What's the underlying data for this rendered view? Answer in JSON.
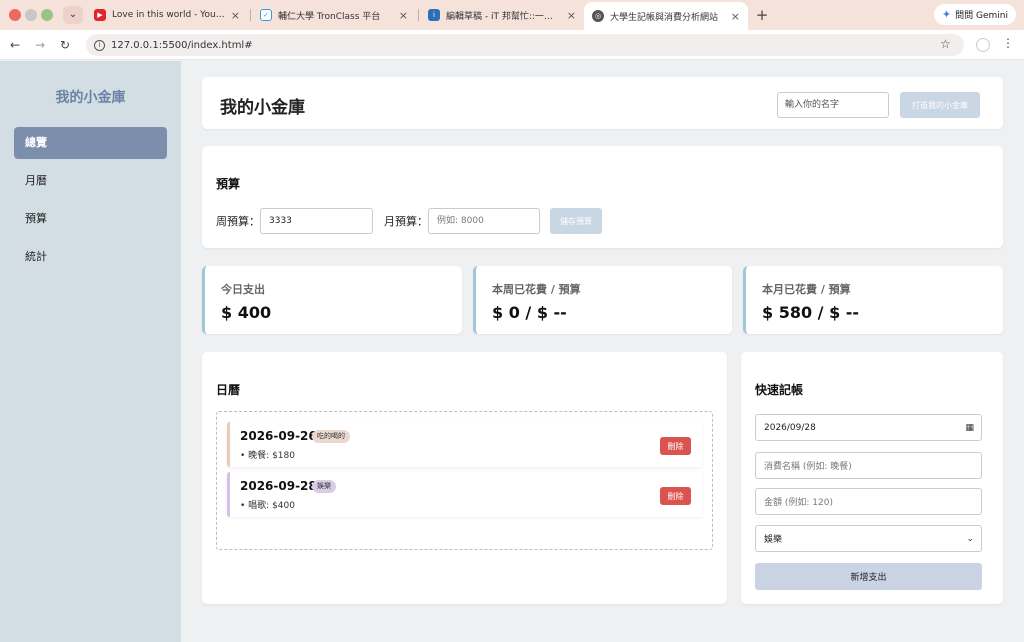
{
  "browser": {
    "tabs": [
      {
        "title": "Love in this world - YouTube",
        "favicon": "youtube-icon",
        "color": "#e0262b"
      },
      {
        "title": "輔仁大學 TronClass 平台",
        "favicon": "tronclass-icon",
        "color": "#3a9ad9"
      },
      {
        "title": "編輯草稿 - iT 邦幫忙::一起幫忙",
        "favicon": "ithome-icon",
        "color": "#2c6fb6"
      },
      {
        "title": "大學生記帳與消費分析網站",
        "favicon": "globe-icon",
        "color": "#555555"
      }
    ],
    "gemini_label": "問問 Gemini",
    "url": "127.0.0.1:5500/index.html#"
  },
  "sidebar": {
    "brand": "我的小金庫",
    "items": [
      {
        "label": "總覽",
        "active": true
      },
      {
        "label": "月曆",
        "active": false
      },
      {
        "label": "預算",
        "active": false
      },
      {
        "label": "統計",
        "active": false
      }
    ]
  },
  "header": {
    "title": "我的小金庫",
    "name_placeholder": "輸入你的名字",
    "create_button": "打造我的小金庫"
  },
  "budget": {
    "title": "預算",
    "weekly_label": "周預算：",
    "weekly_value": "3333",
    "monthly_label": "月預算：",
    "monthly_placeholder": "例如: 8000",
    "save_button": "儲存預算"
  },
  "stats": [
    {
      "label": "今日支出",
      "value": "$ 400"
    },
    {
      "label": "本周已花費 / 預算",
      "value": "$ 0 / $ --"
    },
    {
      "label": "本月已花費 / 預算",
      "value": "$ 580 / $ --"
    }
  ],
  "calendar": {
    "title": "日曆",
    "entries": [
      {
        "date": "2026-09-26",
        "tag": "吃的喝的",
        "tag_color": "#ead7cd",
        "bar_color": "#efc9b8",
        "detail": "• 晚餐: $180",
        "delete_label": "刪除"
      },
      {
        "date": "2026-09-28",
        "tag": "娛樂",
        "tag_color": "#d7cde6",
        "bar_color": "#d2c3e6",
        "detail": "• 唱歌: $400",
        "delete_label": "刪除"
      }
    ]
  },
  "quick": {
    "title": "快速記帳",
    "date_value": "2026/09/28",
    "name_placeholder": "消費名稱 (例如: 晚餐)",
    "amount_placeholder": "金額 (例如: 120)",
    "category_value": "娛樂",
    "add_button": "新增支出"
  }
}
